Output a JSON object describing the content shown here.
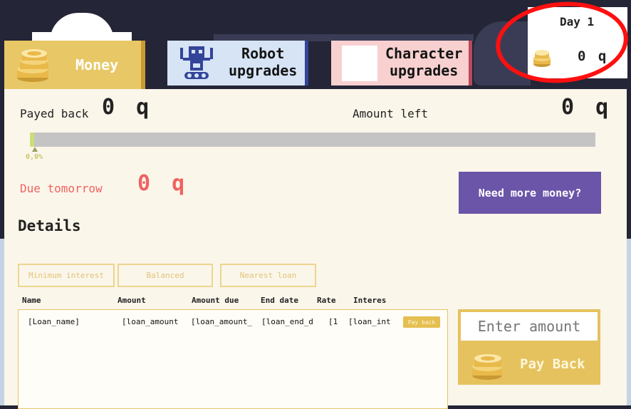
{
  "tabs": [
    {
      "label": "Money",
      "icon": "coin-stack-icon"
    },
    {
      "label": "Robot\nupgrades",
      "icon": "robot-icon"
    },
    {
      "label": "Character\nupgrades",
      "icon": "character-portrait-placeholder"
    }
  ],
  "day_panel": {
    "day_label": "Day 1",
    "balance": "0 q"
  },
  "summary": {
    "payed_back_label": "Payed back",
    "payed_back_value": "0 q",
    "amount_left_label": "Amount left",
    "amount_left_value": "0 q",
    "progress_percent_label": "0,0%",
    "progress_fraction": 0.008
  },
  "due": {
    "label": "Due tomorrow",
    "value": "0 q"
  },
  "need_money_button": "Need more money?",
  "details_heading": "Details",
  "filters": [
    "Minimum interest",
    "Balanced",
    "Nearest loan"
  ],
  "table": {
    "columns": [
      "Name",
      "Amount",
      "Amount due",
      "End date",
      "Rate",
      "Interes"
    ],
    "rows": [
      {
        "name": "[Loan_name]",
        "amount": "[loan_amount",
        "amount_due": "[loan_amount_",
        "end_date": "[loan_end_d",
        "rate": "[1",
        "interest": "[loan_int",
        "action": "Pay back"
      }
    ]
  },
  "pay_panel": {
    "input_placeholder": "Enter amount",
    "button_label": "Pay Back"
  },
  "colors": {
    "money_tab": "#e8c766",
    "robot_tab": "#d6e4f5",
    "character_tab": "#f8d0d0",
    "panel_bg": "#fbf6ea",
    "accent_purple": "#6a55a8",
    "due_red": "#f06262",
    "gold": "#e5c25e",
    "highlight_ring": "#ff1010"
  }
}
